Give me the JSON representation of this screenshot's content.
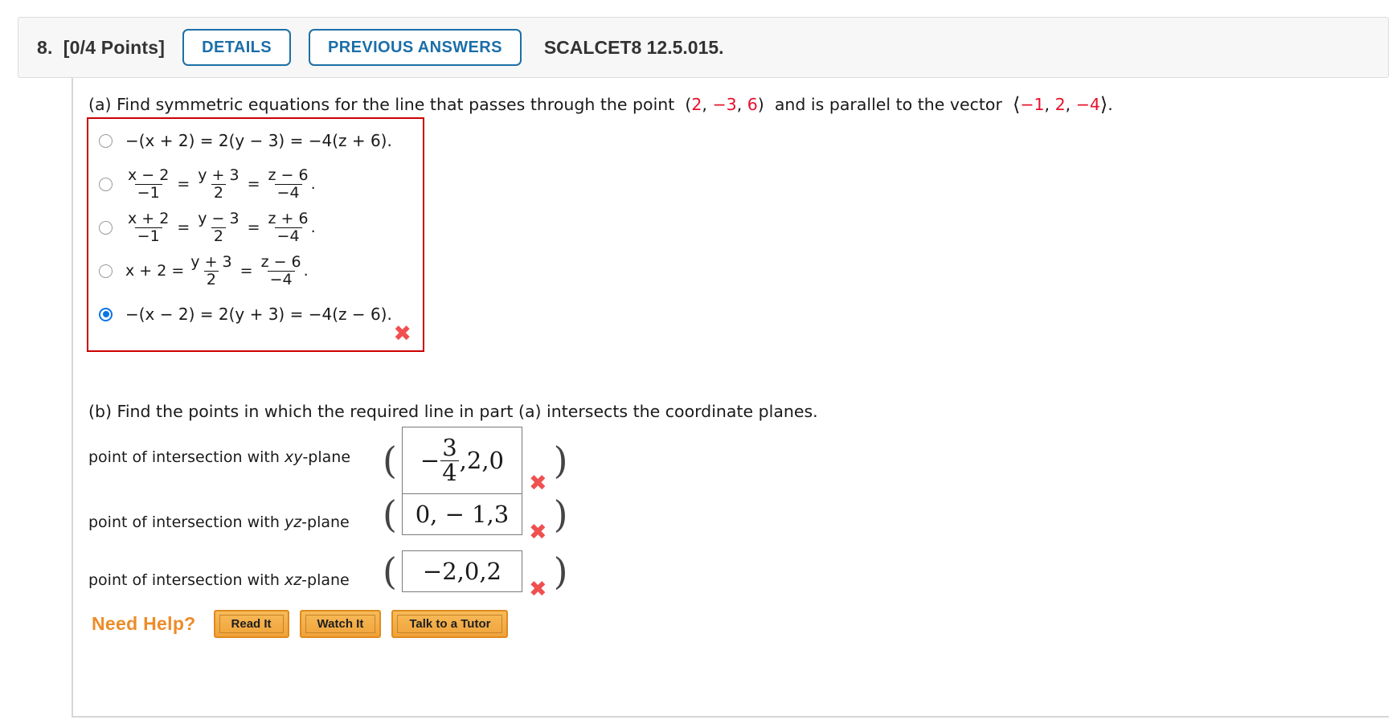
{
  "header": {
    "question_number": "8.",
    "points": "[0/4 Points]",
    "details_button": "DETAILS",
    "previous_answers_button": "PREVIOUS ANSWERS",
    "source_code": "SCALCET8 12.5.015.",
    "accent_blue": "#1b6ea8"
  },
  "part_a": {
    "prompt_lead": "(a) Find symmetric equations for the line that passes through the point",
    "point": "(2, −3, 6)",
    "point_open": "(",
    "point_x": "2",
    "point_y": "−3",
    "point_z": "6",
    "prompt_mid": "and is parallel to the vector",
    "vector_x": "−1",
    "vector_y": "2",
    "vector_z": "−4",
    "prompt_end": ".",
    "error_mark": "✖",
    "error_color": "#f0504f",
    "box_border_color": "#cc0000",
    "choices": [
      {
        "id": "choice-1",
        "type": "plain",
        "text": "−(x + 2) = 2(y − 3) = −4(z + 6).",
        "selected": false
      },
      {
        "id": "choice-2",
        "type": "fractions",
        "lead": "",
        "terms": [
          {
            "num": "x − 2",
            "den": "−1"
          },
          {
            "num": "y + 3",
            "den": "2"
          },
          {
            "num": "z − 6",
            "den": "−4"
          }
        ],
        "tail": ".",
        "selected": false
      },
      {
        "id": "choice-3",
        "type": "fractions",
        "lead": "",
        "terms": [
          {
            "num": "x + 2",
            "den": "−1"
          },
          {
            "num": "y − 3",
            "den": "2"
          },
          {
            "num": "z + 6",
            "den": "−4"
          }
        ],
        "tail": ".",
        "selected": false
      },
      {
        "id": "choice-4",
        "type": "fractions",
        "lead": "x + 2 =",
        "terms": [
          {
            "num": "y + 3",
            "den": "2"
          },
          {
            "num": "z − 6",
            "den": "−4"
          }
        ],
        "tail": ".",
        "selected": false
      },
      {
        "id": "choice-5",
        "type": "plain",
        "text": "−(x − 2) = 2(y + 3) = −4(z − 6).",
        "selected": true
      }
    ]
  },
  "part_b": {
    "prompt": "(b) Find the points in which the required line in part (a) intersects the coordinate planes.",
    "rows": [
      {
        "label_lead": "point of intersection with ",
        "label_plane": "xy",
        "label_tail": "-plane",
        "open_paren": "(",
        "close_paren": ")",
        "value_type": "fraction-mix",
        "value_sign": "−",
        "value_num": "3",
        "value_den": "4",
        "value_rest": ",2,0",
        "value_plain": "−3/4,2,0",
        "error_mark": "✖"
      },
      {
        "label_lead": "point of intersection with ",
        "label_plane": "yz",
        "label_tail": "-plane",
        "open_paren": "(",
        "close_paren": ")",
        "value_type": "plain",
        "value_plain": "0, − 1,3",
        "error_mark": "✖"
      },
      {
        "label_lead": "point of intersection with ",
        "label_plane": "xz",
        "label_tail": "-plane",
        "open_paren": "(",
        "close_paren": ")",
        "value_type": "plain",
        "value_plain": "−2,0,2",
        "error_mark": "✖"
      }
    ]
  },
  "need_help": {
    "label": "Need Help?",
    "buttons": [
      "Read It",
      "Watch It",
      "Talk to a Tutor"
    ],
    "accent_orange": "#ee8b28"
  }
}
